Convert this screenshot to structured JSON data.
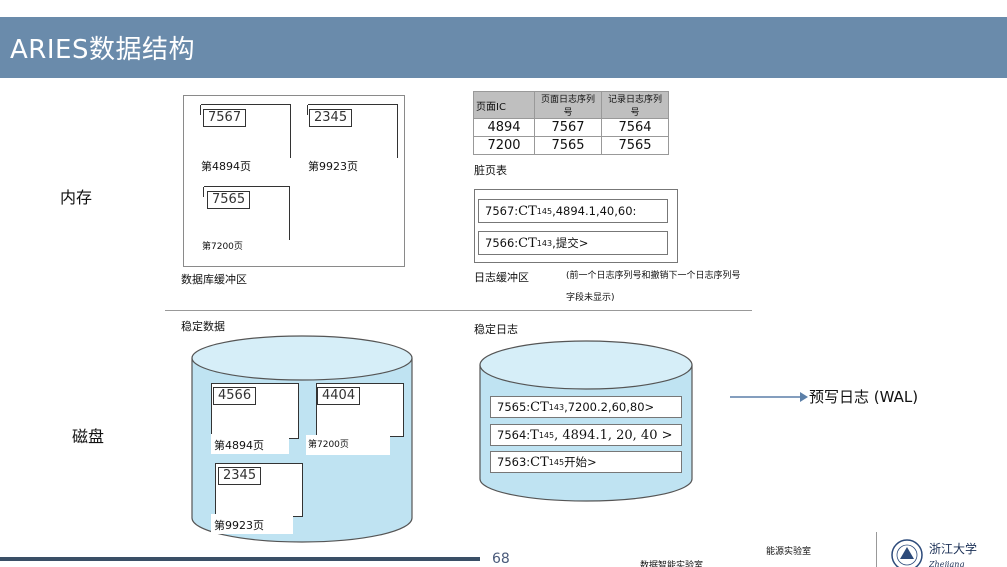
{
  "title": "ARIES数据结构",
  "labels": {
    "memory": "内存",
    "disk": "磁盘"
  },
  "buffer_pool": {
    "caption": "数据库缓冲区",
    "pages": [
      {
        "lsn": "7567",
        "label": "第4894页"
      },
      {
        "lsn": "2345",
        "label": "第9923页"
      },
      {
        "lsn": "7565",
        "label": "第7200页"
      }
    ]
  },
  "dirty_page_table": {
    "caption": "脏页表",
    "headers": [
      "页面IC",
      "页面日志序列号",
      "记录日志序列号"
    ],
    "rows": [
      [
        "4894",
        "7567",
        "7564"
      ],
      [
        "7200",
        "7565",
        "7565"
      ]
    ]
  },
  "log_buffer": {
    "caption": "日志缓冲区",
    "note_line1": "(前一个日志序列号和撤销下一个日志序列号",
    "note_line2": "字段未显示)",
    "entries": [
      {
        "prefix": "7567: ",
        "ct": "CT",
        "sub": "145",
        "rest": " ,4894.1,40,60:"
      },
      {
        "prefix": "7566: ",
        "ct": "CT",
        "sub": "143",
        "rest": " ,提交>"
      }
    ]
  },
  "stable_data": {
    "caption": "稳定数据",
    "pages": [
      {
        "lsn": "4566",
        "label": "第4894页"
      },
      {
        "lsn": "4404",
        "label": "第7200页"
      },
      {
        "lsn": "2345",
        "label": "第9923页"
      }
    ]
  },
  "stable_log": {
    "caption": "稳定日志",
    "entries": [
      {
        "prefix": "7565: ",
        "ct": "CT",
        "sub": "143",
        "rest": " ,7200.2,60,80>"
      },
      {
        "prefix": "7564: ",
        "ct": "T",
        "sub": "145",
        "rest": " , 4894.1, 20, 40 >"
      },
      {
        "prefix": "7563: ",
        "ct": "CT",
        "sub": "145",
        "rest": " 开始>"
      }
    ]
  },
  "wal_label": "预写日志 (WAL)",
  "footer": {
    "page_number": "68",
    "lab1": "能源实验室",
    "lab2": "数据智能实验室",
    "university": "浙江大学",
    "university_en": "Zhejiang University"
  },
  "colors": {
    "title_bar": "#6a8bab",
    "cylinder_fill": "#bfe3f2",
    "cylinder_stroke": "#555555"
  }
}
